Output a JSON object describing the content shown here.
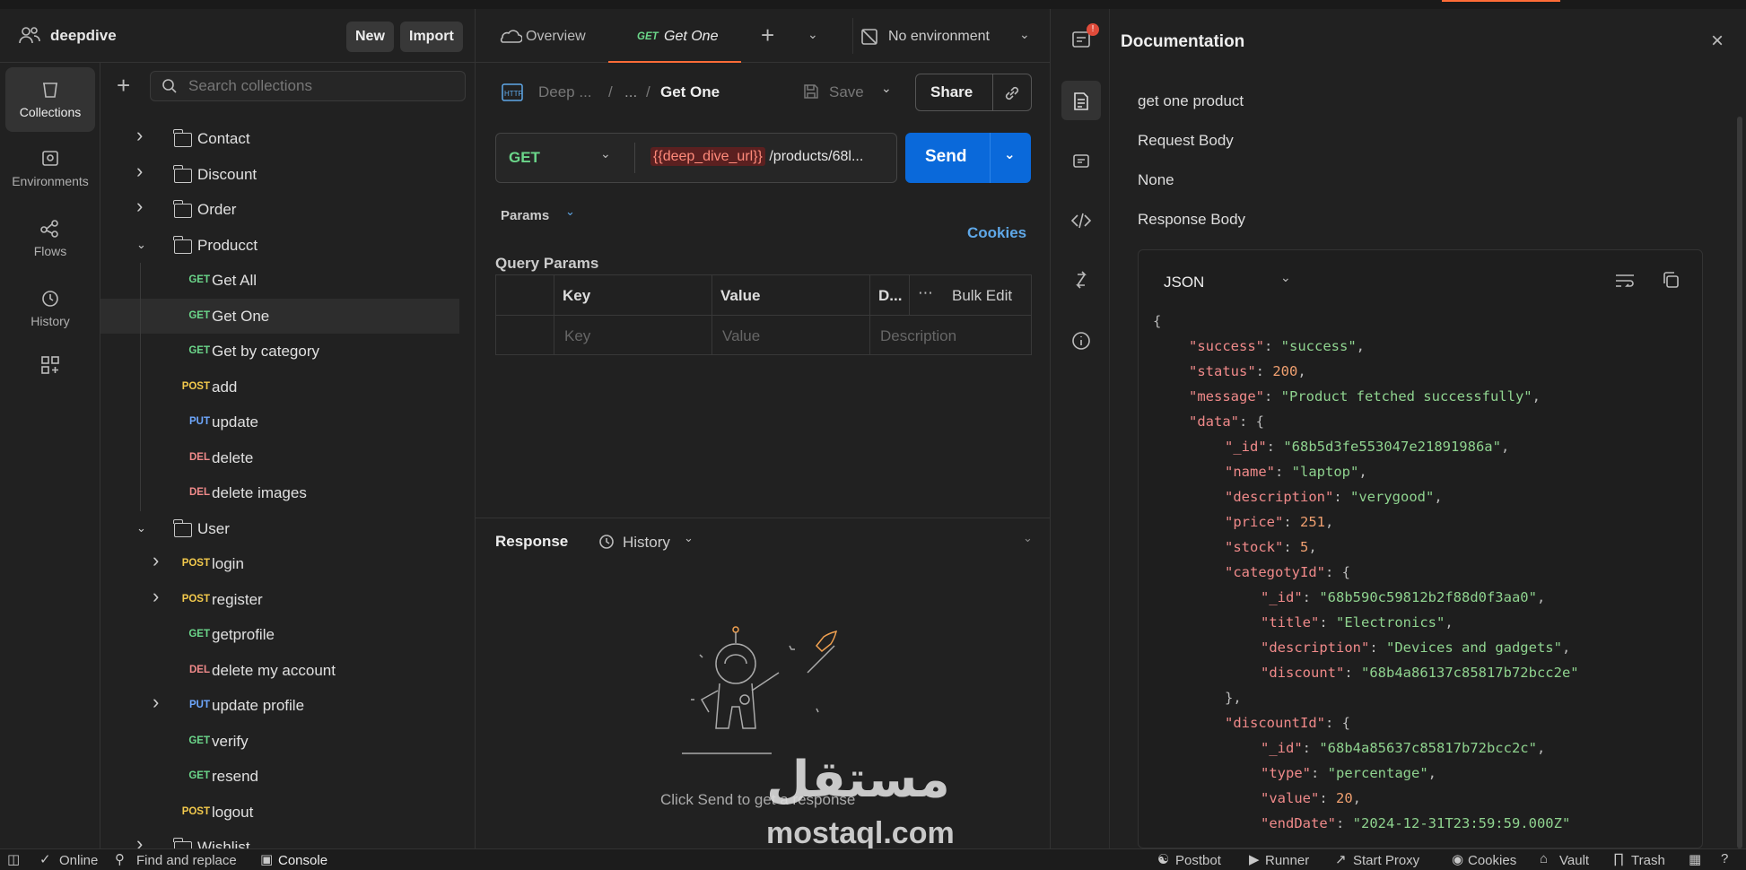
{
  "workspace": {
    "name": "deepdive",
    "new_label": "New",
    "import_label": "Import"
  },
  "rail": {
    "items": [
      {
        "label": "Collections"
      },
      {
        "label": "Environments"
      },
      {
        "label": "Flows"
      },
      {
        "label": "History"
      }
    ]
  },
  "sidebar": {
    "search_placeholder": "Search collections",
    "tree": [
      {
        "type": "folder",
        "label": "Contact",
        "expanded": false
      },
      {
        "type": "folder",
        "label": "Discount",
        "expanded": false
      },
      {
        "type": "folder",
        "label": "Order",
        "expanded": false
      },
      {
        "type": "folder",
        "label": "Producct",
        "expanded": true
      },
      {
        "type": "request",
        "method": "GET",
        "label": "Get All"
      },
      {
        "type": "request",
        "method": "GET",
        "label": "Get One",
        "selected": true
      },
      {
        "type": "request",
        "method": "GET",
        "label": "Get by category"
      },
      {
        "type": "request",
        "method": "POST",
        "label": "add"
      },
      {
        "type": "request",
        "method": "PUT",
        "label": "update"
      },
      {
        "type": "request",
        "method": "DEL",
        "label": "delete"
      },
      {
        "type": "request",
        "method": "DEL",
        "label": "delete images"
      },
      {
        "type": "folder",
        "label": "User",
        "expanded": true
      },
      {
        "type": "request",
        "method": "POST",
        "label": "login",
        "chevron": true
      },
      {
        "type": "request",
        "method": "POST",
        "label": "register",
        "chevron": true
      },
      {
        "type": "request",
        "method": "GET",
        "label": "getprofile"
      },
      {
        "type": "request",
        "method": "DEL",
        "label": "delete my account"
      },
      {
        "type": "request",
        "method": "PUT",
        "label": "update profile",
        "chevron": true
      },
      {
        "type": "request",
        "method": "GET",
        "label": "verify"
      },
      {
        "type": "request",
        "method": "GET",
        "label": "resend"
      },
      {
        "type": "request",
        "method": "POST",
        "label": "logout"
      },
      {
        "type": "folder",
        "label": "Wishlist",
        "expanded": false
      }
    ]
  },
  "tabs": {
    "overview": "Overview",
    "active_method": "GET",
    "active_name": "Get One",
    "environment": "No environment"
  },
  "request": {
    "breadcrumb_collection": "Deep ...",
    "breadcrumb_mid": "...",
    "breadcrumb_name": "Get One",
    "save_label": "Save",
    "share_label": "Share",
    "method": "GET",
    "url_variable": "{{deep_dive_url}}",
    "url_rest": "/products/68l...",
    "send_label": "Send",
    "params_tab": "Params",
    "cookies_label": "Cookies",
    "query_params_title": "Query Params",
    "table": {
      "headers": [
        "Key",
        "Value",
        "D...",
        "Bulk Edit"
      ],
      "placeholders": [
        "Key",
        "Value",
        "Description"
      ]
    }
  },
  "response": {
    "title": "Response",
    "history_label": "History",
    "empty_text": "Click Send to get a response"
  },
  "documentation": {
    "title": "Documentation",
    "description": "get one product",
    "request_body_label": "Request Body",
    "request_body_value": "None",
    "response_body_label": "Response Body",
    "format": "JSON",
    "code_lines": [
      {
        "i": 0,
        "parts": [
          [
            "p",
            "{"
          ]
        ]
      },
      {
        "i": 1,
        "parts": [
          [
            "k",
            "\"success\""
          ],
          [
            "p",
            ": "
          ],
          [
            "s",
            "\"success\""
          ],
          [
            "p",
            ","
          ]
        ]
      },
      {
        "i": 1,
        "parts": [
          [
            "k",
            "\"status\""
          ],
          [
            "p",
            ": "
          ],
          [
            "n",
            "200"
          ],
          [
            "p",
            ","
          ]
        ]
      },
      {
        "i": 1,
        "parts": [
          [
            "k",
            "\"message\""
          ],
          [
            "p",
            ": "
          ],
          [
            "s",
            "\"Product fetched successfully\""
          ],
          [
            "p",
            ","
          ]
        ]
      },
      {
        "i": 1,
        "parts": [
          [
            "k",
            "\"data\""
          ],
          [
            "p",
            ": {"
          ]
        ]
      },
      {
        "i": 2,
        "parts": [
          [
            "k",
            "\"_id\""
          ],
          [
            "p",
            ": "
          ],
          [
            "s",
            "\"68b5d3fe553047e21891986a\""
          ],
          [
            "p",
            ","
          ]
        ]
      },
      {
        "i": 2,
        "parts": [
          [
            "k",
            "\"name\""
          ],
          [
            "p",
            ": "
          ],
          [
            "s",
            "\"laptop\""
          ],
          [
            "p",
            ","
          ]
        ]
      },
      {
        "i": 2,
        "parts": [
          [
            "k",
            "\"description\""
          ],
          [
            "p",
            ": "
          ],
          [
            "s",
            "\"verygood\""
          ],
          [
            "p",
            ","
          ]
        ]
      },
      {
        "i": 2,
        "parts": [
          [
            "k",
            "\"price\""
          ],
          [
            "p",
            ": "
          ],
          [
            "n",
            "251"
          ],
          [
            "p",
            ","
          ]
        ]
      },
      {
        "i": 2,
        "parts": [
          [
            "k",
            "\"stock\""
          ],
          [
            "p",
            ": "
          ],
          [
            "n",
            "5"
          ],
          [
            "p",
            ","
          ]
        ]
      },
      {
        "i": 2,
        "parts": [
          [
            "k",
            "\"categotyId\""
          ],
          [
            "p",
            ": {"
          ]
        ]
      },
      {
        "i": 3,
        "parts": [
          [
            "k",
            "\"_id\""
          ],
          [
            "p",
            ": "
          ],
          [
            "s",
            "\"68b590c59812b2f88d0f3aa0\""
          ],
          [
            "p",
            ","
          ]
        ]
      },
      {
        "i": 3,
        "parts": [
          [
            "k",
            "\"title\""
          ],
          [
            "p",
            ": "
          ],
          [
            "s",
            "\"Electronics\""
          ],
          [
            "p",
            ","
          ]
        ]
      },
      {
        "i": 3,
        "parts": [
          [
            "k",
            "\"description\""
          ],
          [
            "p",
            ": "
          ],
          [
            "s",
            "\"Devices and gadgets\""
          ],
          [
            "p",
            ","
          ]
        ]
      },
      {
        "i": 3,
        "parts": [
          [
            "k",
            "\"discount\""
          ],
          [
            "p",
            ": "
          ],
          [
            "s",
            "\"68b4a86137c85817b72bcc2e\""
          ]
        ]
      },
      {
        "i": 2,
        "parts": [
          [
            "p",
            "},"
          ]
        ]
      },
      {
        "i": 2,
        "parts": [
          [
            "k",
            "\"discountId\""
          ],
          [
            "p",
            ": {"
          ]
        ]
      },
      {
        "i": 3,
        "parts": [
          [
            "k",
            "\"_id\""
          ],
          [
            "p",
            ": "
          ],
          [
            "s",
            "\"68b4a85637c85817b72bcc2c\""
          ],
          [
            "p",
            ","
          ]
        ]
      },
      {
        "i": 3,
        "parts": [
          [
            "k",
            "\"type\""
          ],
          [
            "p",
            ": "
          ],
          [
            "s",
            "\"percentage\""
          ],
          [
            "p",
            ","
          ]
        ]
      },
      {
        "i": 3,
        "parts": [
          [
            "k",
            "\"value\""
          ],
          [
            "p",
            ": "
          ],
          [
            "n",
            "20"
          ],
          [
            "p",
            ","
          ]
        ]
      },
      {
        "i": 3,
        "parts": [
          [
            "k",
            "\"endDate\""
          ],
          [
            "p",
            ": "
          ],
          [
            "s",
            "\"2024-12-31T23:59:59.000Z\""
          ]
        ]
      }
    ]
  },
  "statusbar": {
    "online": "Online",
    "find_replace": "Find and replace",
    "console": "Console",
    "postbot": "Postbot",
    "runner": "Runner",
    "start_proxy": "Start Proxy",
    "cookies": "Cookies",
    "vault": "Vault",
    "trash": "Trash"
  },
  "watermark": {
    "arabic": "مستقل",
    "latin": "mostaql.com"
  },
  "colors": {
    "accent": "#ff6c37",
    "send": "#0a69da",
    "get": "#6bd68a",
    "post": "#f2c94c",
    "put": "#6ea8ff",
    "del": "#f08a8a"
  }
}
